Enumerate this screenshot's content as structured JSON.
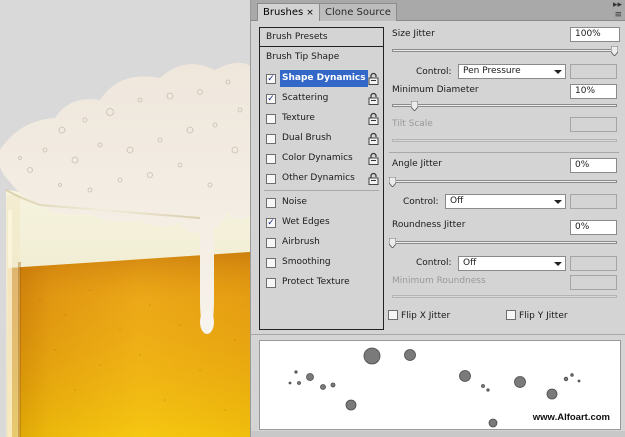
{
  "tabs": [
    {
      "label": "Brushes",
      "close": "×",
      "active": true
    },
    {
      "label": "Clone Source",
      "active": false
    }
  ],
  "panel_menu": {
    "collapse": "▸▸",
    "menu": "≡"
  },
  "brush_list": {
    "presets_label": "Brush Presets",
    "tip_shape_label": "Brush Tip Shape",
    "options": [
      {
        "label": "Shape Dynamics",
        "checked": true,
        "selected": true
      },
      {
        "label": "Scattering",
        "checked": true,
        "selected": false
      },
      {
        "label": "Texture",
        "checked": false,
        "selected": false
      },
      {
        "label": "Dual Brush",
        "checked": false,
        "selected": false
      },
      {
        "label": "Color Dynamics",
        "checked": false,
        "selected": false
      },
      {
        "label": "Other Dynamics",
        "checked": false,
        "selected": false
      },
      {
        "label": "Noise",
        "checked": false,
        "selected": false
      },
      {
        "label": "Wet Edges",
        "checked": true,
        "selected": false
      },
      {
        "label": "Airbrush",
        "checked": false,
        "selected": false
      },
      {
        "label": "Smoothing",
        "checked": false,
        "selected": false
      },
      {
        "label": "Protect Texture",
        "checked": false,
        "selected": false
      }
    ],
    "check_mark": "✓"
  },
  "controls": {
    "size_jitter": {
      "label": "Size Jitter",
      "value": "100%",
      "level": 1.0
    },
    "size_control": {
      "label": "Control:",
      "value": "Pen Pressure"
    },
    "min_diameter": {
      "label": "Minimum Diameter",
      "value": "10%",
      "level": 0.1
    },
    "tilt_scale": {
      "label": "Tilt Scale"
    },
    "angle_jitter": {
      "label": "Angle Jitter",
      "value": "0%",
      "level": 0.0
    },
    "angle_control": {
      "label": "Control:",
      "value": "Off"
    },
    "roundness_jitter": {
      "label": "Roundness Jitter",
      "value": "0%",
      "level": 0.0
    },
    "roundness_control": {
      "label": "Control:",
      "value": "Off"
    },
    "min_roundness": {
      "label": "Minimum Roundness"
    },
    "flip_x": {
      "label": "Flip X Jitter",
      "checked": false
    },
    "flip_y": {
      "label": "Flip Y Jitter",
      "checked": false
    }
  },
  "watermark": "www.Alfoart.com",
  "colors": {
    "selection": "#3468c8",
    "panel_bg": "#d4d4d4",
    "beer": "#e8a010",
    "foam": "#f4efe8"
  }
}
